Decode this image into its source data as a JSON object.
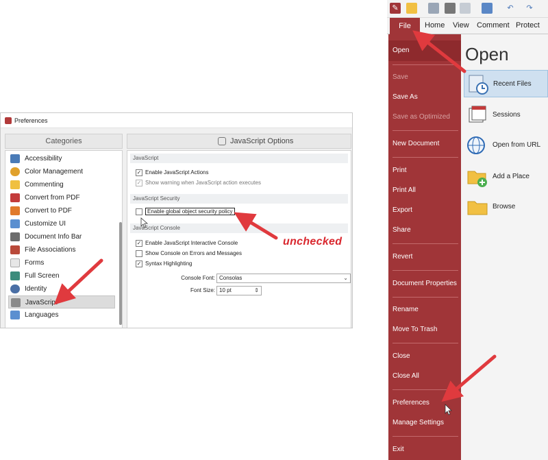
{
  "preferences": {
    "title": "Preferences",
    "categories_header": "Categories",
    "categories": [
      {
        "label": "Accessibility",
        "icon": "accessibility-icon",
        "color": "#4a7bb7"
      },
      {
        "label": "Color Management",
        "icon": "color-wheel-icon",
        "color": "#e0a12c"
      },
      {
        "label": "Commenting",
        "icon": "comment-note-icon",
        "color": "#f0c040"
      },
      {
        "label": "Convert from PDF",
        "icon": "pdf-convert-icon",
        "color": "#c33b3b"
      },
      {
        "label": "Convert to PDF",
        "icon": "convert-puzzle-icon",
        "color": "#e07a2c"
      },
      {
        "label": "Customize UI",
        "icon": "customize-ui-icon",
        "color": "#5a8fd0"
      },
      {
        "label": "Document Info Bar",
        "icon": "info-bar-icon",
        "color": "#6c6c6c"
      },
      {
        "label": "File Associations",
        "icon": "file-association-icon",
        "color": "#b94a3a"
      },
      {
        "label": "Forms",
        "icon": "forms-icon",
        "color": "#e7e7e7"
      },
      {
        "label": "Full Screen",
        "icon": "full-screen-icon",
        "color": "#3c8c7c"
      },
      {
        "label": "Identity",
        "icon": "identity-icon",
        "color": "#4a6fa5"
      },
      {
        "label": "JavaScript",
        "icon": "javascript-icon",
        "color": "#8a8a8a"
      },
      {
        "label": "Languages",
        "icon": "languages-icon",
        "color": "#5b8fd0"
      }
    ],
    "selected_category": "JavaScript",
    "options_header": "JavaScript Options",
    "sections": {
      "javascript": {
        "title": "JavaScript",
        "items": [
          {
            "label": "Enable JavaScript Actions",
            "checked": true,
            "enabled": true
          },
          {
            "label": "Show warning when JavaScript action executes",
            "checked": true,
            "enabled": false
          }
        ]
      },
      "security": {
        "title": "JavaScript Security",
        "items": [
          {
            "label": "Enable global object security policy",
            "checked": false,
            "enabled": true
          }
        ]
      },
      "console": {
        "title": "JavaScript Console",
        "items": [
          {
            "label": "Enable JavaScript Interactive Console",
            "checked": true
          },
          {
            "label": "Show Console on Errors and Messages",
            "checked": false
          },
          {
            "label": "Syntax Highlighting",
            "checked": true
          }
        ],
        "console_font_label": "Console Font:",
        "console_font_value": "Consolas",
        "font_size_label": "Font Size:",
        "font_size_value": "10 pt"
      }
    },
    "annotation_text": "unchecked"
  },
  "backstage": {
    "tabs": [
      "File",
      "Home",
      "View",
      "Comment",
      "Protect"
    ],
    "menu": [
      {
        "label": "Open",
        "state": "active"
      },
      {
        "label": "Save",
        "state": "disabled"
      },
      {
        "label": "Save As",
        "state": "normal"
      },
      {
        "label": "Save as Optimized",
        "state": "disabled"
      },
      {
        "label": "New Document",
        "state": "normal"
      },
      {
        "label": "Print",
        "state": "normal"
      },
      {
        "label": "Print All",
        "state": "normal"
      },
      {
        "label": "Export",
        "state": "normal"
      },
      {
        "label": "Share",
        "state": "normal"
      },
      {
        "label": "Revert",
        "state": "normal"
      },
      {
        "label": "Document Properties",
        "state": "normal"
      },
      {
        "label": "Rename",
        "state": "normal"
      },
      {
        "label": "Move To Trash",
        "state": "normal"
      },
      {
        "label": "Close",
        "state": "normal"
      },
      {
        "label": "Close All",
        "state": "normal"
      },
      {
        "label": "Preferences",
        "state": "normal"
      },
      {
        "label": "Manage Settings",
        "state": "normal"
      },
      {
        "label": "Exit",
        "state": "normal"
      }
    ],
    "open_title": "Open",
    "open_items": [
      {
        "label": "Recent Files",
        "icon": "recent-files-clock-icon",
        "selected": true
      },
      {
        "label": "Sessions",
        "icon": "sessions-icon",
        "selected": false
      },
      {
        "label": "Open from URL",
        "icon": "globe-link-icon",
        "selected": false
      },
      {
        "label": "Add a Place",
        "icon": "add-place-folder-icon",
        "selected": false
      },
      {
        "label": "Browse",
        "icon": "browse-folder-icon",
        "selected": false
      }
    ]
  },
  "colors": {
    "menu_red": "#a03538",
    "annotation_red": "#e03a3e",
    "selection_blue": "#cfe0f0"
  }
}
